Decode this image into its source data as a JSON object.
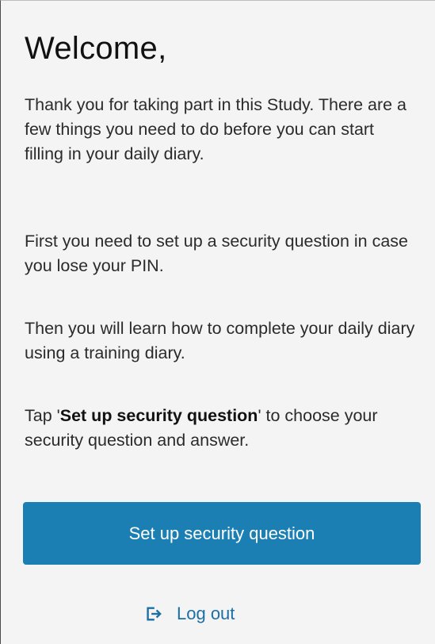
{
  "welcome": {
    "title": "Welcome,",
    "paragraph1": "Thank you for taking part in this Study. There are a few things you need to do before you can start filling in your daily diary.",
    "paragraph2": "First you need to set up a security question in case you lose your PIN.",
    "paragraph3": "Then you will learn how to complete your daily diary using a training diary.",
    "paragraph4_prefix": "Tap '",
    "paragraph4_bold": "Set up security question",
    "paragraph4_suffix": "' to choose your security question and answer."
  },
  "actions": {
    "setup_button_label": "Set up security question",
    "logout_label": "Log out",
    "logout_icon": "logout-icon"
  },
  "colors": {
    "background": "#f4f4f4",
    "primary": "#1b7fb3",
    "link": "#1b6fa5"
  }
}
